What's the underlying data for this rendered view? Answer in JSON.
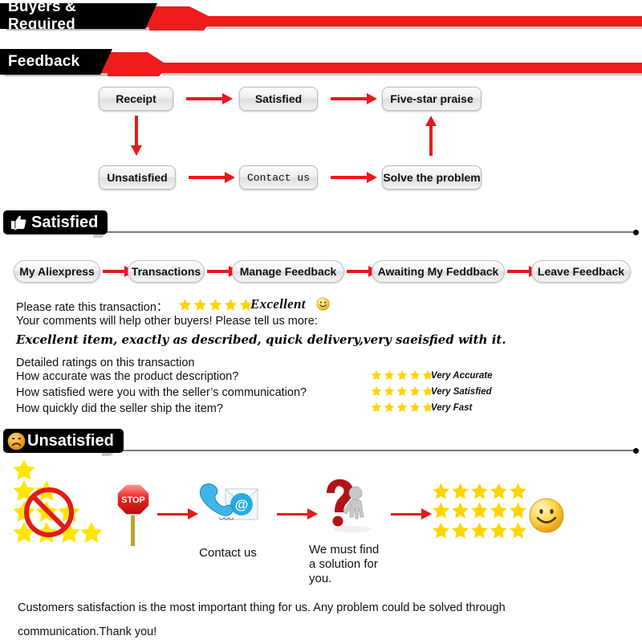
{
  "headers": {
    "buyers_required": "Buyers & Required",
    "feedback": "Feedback"
  },
  "flowchart": {
    "nodes": [
      {
        "id": "receipt",
        "label": "Receipt"
      },
      {
        "id": "satisfied",
        "label": "Satisfied"
      },
      {
        "id": "five_star",
        "label": "Five-star praise"
      },
      {
        "id": "unsatisfied",
        "label": "Unsatisfied"
      },
      {
        "id": "contact_us",
        "label": "Contact us"
      },
      {
        "id": "solve",
        "label": "Solve the problem"
      }
    ]
  },
  "satisfied_section": {
    "title": "Satisfied",
    "icon": "thumbs-up-icon",
    "breadcrumbs": [
      "My Aliexpress",
      "Transactions",
      "Manage Feedback",
      "Awaiting My Feddback",
      "Leave Feedback"
    ],
    "rate_prompt": "Please rate this transaction：",
    "rate_stars": 5,
    "rate_word": "Excellent",
    "rate_emoji": "smiley-face-icon",
    "comments_prompt": "Your comments will help other buyers! Please tell us more:",
    "comment_text": "Excellent item, exactly as described, quick delivery,very saeisfied with it.",
    "detailed_heading": "Detailed ratings on this transaction",
    "detailed_rows": [
      {
        "question": "How accurate was the product description?",
        "stars": 5,
        "word": "Very Accurate"
      },
      {
        "question": "How satisfied were you with the seller’s communication?",
        "stars": 5,
        "word": "Very Satisfied"
      },
      {
        "question": "How quickly did the seller ship the item?",
        "stars": 5,
        "word": "Very Fast"
      }
    ]
  },
  "unsatisfied_section": {
    "title": "Unsatisfied",
    "icon": "sad-face-icon",
    "steps": [
      {
        "id": "bad-rating",
        "icon": "no-entry-over-stars-icon",
        "caption": ""
      },
      {
        "id": "stop",
        "icon": "stop-sign-icon",
        "caption": ""
      },
      {
        "id": "contact",
        "icon": "phone-email-icon",
        "caption": "Contact us"
      },
      {
        "id": "solution",
        "icon": "question-mark-person-icon",
        "caption": "We must find a solution for you."
      },
      {
        "id": "happy",
        "icon": "five-star-grid-icon",
        "caption": ""
      }
    ],
    "stop_sign_text": "STOP",
    "contact_caption": "Contact us",
    "solution_caption_line1": "We must find",
    "solution_caption_line2": "a solution for",
    "solution_caption_line3": "you.",
    "happy_emoji": "smiley-face-icon"
  },
  "footer": {
    "line1": "Customers satisfaction is the most important thing for us. Any problem could be solved through",
    "line2": "communication.Thank you!"
  },
  "colors": {
    "red": "#e8191b",
    "star_yellow": "#ffd400",
    "black": "#000000",
    "rule_gray": "#7a7a7a"
  }
}
